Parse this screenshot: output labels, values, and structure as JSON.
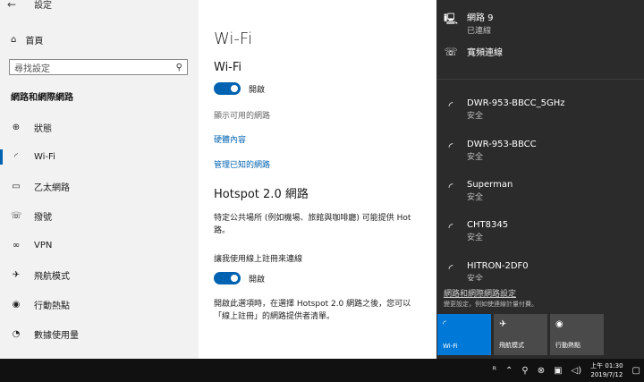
{
  "sidebar": {
    "window_title": "設定",
    "home": "首頁",
    "search_placeholder": "尋找設定",
    "section": "網路和網際網路",
    "items": [
      {
        "label": "狀態",
        "icon": "globe-icon"
      },
      {
        "label": "Wi-Fi",
        "icon": "wifi-icon"
      },
      {
        "label": "乙太網路",
        "icon": "ethernet-icon"
      },
      {
        "label": "撥號",
        "icon": "dialup-icon"
      },
      {
        "label": "VPN",
        "icon": "vpn-icon"
      },
      {
        "label": "飛航模式",
        "icon": "airplane-icon"
      },
      {
        "label": "行動熱點",
        "icon": "hotspot-icon"
      },
      {
        "label": "數據使用量",
        "icon": "data-usage-icon"
      }
    ]
  },
  "main": {
    "title": "Wi-Fi",
    "wifi_heading": "Wi-Fi",
    "wifi_toggle_label": "開啟",
    "show_networks": "顯示可用的網路",
    "hardware_props": "硬體內容",
    "manage_known": "管理已知的網路",
    "hotspot_heading": "Hotspot 2.0 網路",
    "hotspot_desc_line1": "特定公共場所 (例如機場、旅館與咖啡廳) 可能提供 Hot",
    "hotspot_desc_line2": "路。",
    "online_signup_label": "讓我使用線上註冊來連線",
    "online_toggle_label": "開啟",
    "bottom_line1": "開啟此選項時，在選擇 Hotspot 2.0 網路之後，您可以",
    "bottom_line2": "「線上註冊」的網路提供者清單。"
  },
  "flyout": {
    "networks": [
      {
        "name": "網路 9",
        "status": "已連線",
        "icon": "ethernet-monitor-icon"
      },
      {
        "name": "寬頻連線",
        "status": "",
        "icon": "dialup-icon"
      },
      {
        "name": "DWR-953-BBCC_5GHz",
        "status": "安全",
        "icon": "wifi-icon"
      },
      {
        "name": "DWR-953-BBCC",
        "status": "安全",
        "icon": "wifi-icon"
      },
      {
        "name": "Superman",
        "status": "安全",
        "icon": "wifi-icon"
      },
      {
        "name": "CHT8345",
        "status": "安全",
        "icon": "wifi-icon"
      },
      {
        "name": "HITRON-2DF0",
        "status": "安全",
        "icon": "wifi-icon"
      }
    ],
    "settings_link": "網路和網際網路設定",
    "settings_sub": "變更設定，例如使連線計量付費。",
    "tiles": [
      {
        "label": "Wi-Fi",
        "icon": "wifi-icon",
        "active": true
      },
      {
        "label": "飛航模式",
        "icon": "airplane-icon",
        "active": false
      },
      {
        "label": "行動熱點",
        "icon": "hotspot-icon",
        "active": false
      }
    ]
  },
  "taskbar": {
    "time": "上午 01:30",
    "date": "2019/7/12"
  }
}
